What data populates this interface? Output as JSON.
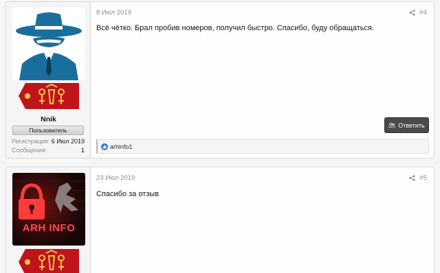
{
  "posts": [
    {
      "username": "Nnik",
      "user_title": "Пользователь",
      "stats": [
        {
          "label": "Регистрация:",
          "value": "6 Июл 2019"
        },
        {
          "label": "Сообщения:",
          "value": "1"
        }
      ],
      "date": "8 Июл 2019",
      "number": "#4",
      "text": "Всё чётко. Брал пробив номеров, получил быстро. Спасибо, буду обращаться.",
      "reply_label": "Ответить",
      "reaction_user": "arhinfo1"
    },
    {
      "avatar_logo_text": "ARH INFO",
      "date": "23 Июл 2019",
      "number": "#5",
      "text": "Спасибо за отзыв"
    }
  ],
  "icons": {
    "share": "share-icon",
    "reply": "users-icon",
    "like": "thumbs-up-icon",
    "avatar_1": "spy-hat-icon",
    "avatar_2": "padlock-icon"
  },
  "colors": {
    "avatar_spy": "#1a6e9d",
    "rank_banner": "#c0141b",
    "rank_gold": "#f2c94a",
    "reply_button": "#4a4a4a",
    "like_blue": "#2577d8"
  }
}
